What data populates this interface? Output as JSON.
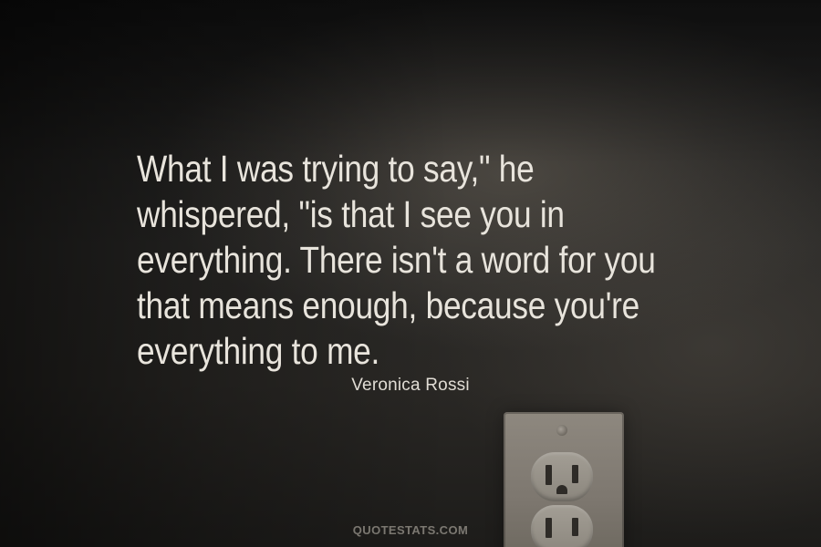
{
  "quote": {
    "lines": [
      "What I was trying to say,\" he",
      "whispered, \"is that I see you in",
      "everything. There isn't a word for you",
      "that means enough, because you're",
      "everything to me."
    ]
  },
  "author": "Veronica Rossi",
  "watermark": "QUOTESTATS.COM",
  "colors": {
    "text": "#e8e4dc",
    "background": "#2a2825"
  },
  "icons": {
    "outlet": "electrical-outlet-icon"
  }
}
